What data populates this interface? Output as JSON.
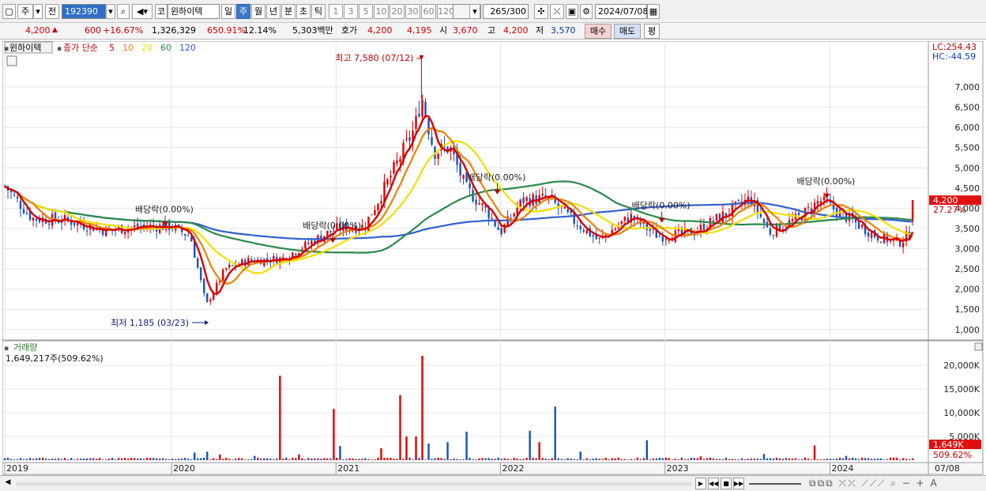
{
  "toolbar": {
    "type_label": "주",
    "jeon_label": "전",
    "code": "192390",
    "code_prefix": "코",
    "name": "윈하이텍",
    "period_buttons": [
      "일",
      "주",
      "월",
      "년",
      "분",
      "초",
      "틱"
    ],
    "active_period": "주",
    "interval_buttons": [
      "1",
      "3",
      "5",
      "10",
      "20",
      "30",
      "60",
      "120"
    ],
    "count_shown": "265",
    "count_total": "/300",
    "date": "2024/07/08"
  },
  "quote": {
    "price": "4,200",
    "change": "600",
    "change_pct": "+16.67%",
    "volume": "1,326,329",
    "volume_ratio": "650.91%",
    "turnover": "12.14%",
    "amount": "5,303백만",
    "hoga_label": "호가",
    "ask": "4,200",
    "bid": "4,195",
    "open_label": "시",
    "open": "3,670",
    "high_label": "고",
    "high": "4,200",
    "low_label": "저",
    "low": "3,570",
    "buy_label": "매수",
    "sell_label": "매도",
    "flat_label": "평"
  },
  "legend": {
    "name": "윈하이텍",
    "ma_title": "종가 단순",
    "periods": [
      "5",
      "10",
      "20",
      "60",
      "120"
    ],
    "colors": [
      "#d40000",
      "#f08000",
      "#f0e000",
      "#2a8a4a",
      "#3060d0"
    ]
  },
  "colors": {
    "up": "#e00000",
    "down": "#1850c0",
    "grid": "#e4e4e4",
    "price_badge": "#e01010"
  },
  "chart_data": [
    {
      "type": "candlestick",
      "title": "윈하이텍",
      "x_unit": "week",
      "x_range": [
        "2019-01-02",
        "2024-07-08"
      ],
      "xticks": [
        "2019",
        "2020",
        "2021",
        "2022",
        "2023",
        "2024",
        "07/08"
      ],
      "ylim": [
        800,
        7900
      ],
      "yticks": [
        "1,000",
        "1,500",
        "2,000",
        "2,500",
        "3,000",
        "3,500",
        "4,000",
        "4,500",
        "5,000",
        "5,500",
        "6,000",
        "6,500",
        "7,000"
      ],
      "right_labels": {
        "lc": "LC:254.43",
        "hc": "HC:-44.59",
        "last_price": "4,200",
        "last_pct": "27.27%"
      },
      "grid": true,
      "legend_position": "top-left",
      "anchor_points": [
        [
          "2019-01-02",
          4550
        ],
        [
          "2019-03-04",
          3750
        ],
        [
          "2019-05-20",
          3700
        ],
        [
          "2019-08-12",
          3450
        ],
        [
          "2019-11-04",
          3550
        ],
        [
          "2020-01-06",
          3550
        ],
        [
          "2020-02-17",
          3300
        ],
        [
          "2020-03-23",
          1600
        ],
        [
          "2020-05-04",
          2500
        ],
        [
          "2020-06-22",
          2700
        ],
        [
          "2020-09-07",
          2750
        ],
        [
          "2020-11-16",
          3200
        ],
        [
          "2021-01-04",
          3500
        ],
        [
          "2021-03-08",
          3550
        ],
        [
          "2021-04-26",
          4600
        ],
        [
          "2021-06-28",
          6000
        ],
        [
          "2021-07-12",
          6800
        ],
        [
          "2021-08-09",
          5400
        ],
        [
          "2021-09-13",
          5500
        ],
        [
          "2021-10-18",
          4500
        ],
        [
          "2021-12-06",
          3900
        ],
        [
          "2022-01-03",
          3400
        ],
        [
          "2022-02-21",
          4200
        ],
        [
          "2022-04-18",
          4250
        ],
        [
          "2022-06-13",
          3700
        ],
        [
          "2022-08-08",
          3200
        ],
        [
          "2022-10-17",
          3800
        ],
        [
          "2022-12-19",
          3300
        ],
        [
          "2023-03-06",
          3400
        ],
        [
          "2023-05-22",
          3900
        ],
        [
          "2023-07-10",
          4250
        ],
        [
          "2023-08-21",
          3400
        ],
        [
          "2023-10-30",
          3800
        ],
        [
          "2023-12-11",
          4200
        ],
        [
          "2024-02-05",
          3800
        ],
        [
          "2024-04-15",
          3300
        ],
        [
          "2024-06-03",
          3150
        ],
        [
          "2024-07-01",
          3400
        ],
        [
          "2024-07-08",
          4200
        ]
      ],
      "annotations": [
        {
          "text": "최고 7,580 (07/12)",
          "x": "2021-07-12",
          "y": 7580,
          "kind": "high"
        },
        {
          "text": "최저 1,185 (03/23)",
          "x": "2020-03-23",
          "y": 1185,
          "kind": "low"
        },
        {
          "text": "배당락(0.00%)",
          "x": "2019-12-23",
          "y": 3700,
          "kind": "dividend"
        },
        {
          "text": "배당락(0.00%)",
          "x": "2020-12-28",
          "y": 3300,
          "kind": "dividend"
        },
        {
          "text": "배당락(0.00%)",
          "x": "2021-12-27",
          "y": 4500,
          "kind": "dividend"
        },
        {
          "text": "배당락(0.00%)",
          "x": "2022-12-26",
          "y": 3800,
          "kind": "dividend"
        },
        {
          "text": "배당락(0.00%)",
          "x": "2023-12-26",
          "y": 4400,
          "kind": "dividend"
        }
      ]
    },
    {
      "type": "bar",
      "title": "거래량",
      "subtitle": "1,649,217주(509.62%)",
      "ylim": [
        0,
        23000
      ],
      "yticks": [
        "5,000K",
        "10,000K",
        "15,000K",
        "20,000K"
      ],
      "right_labels": {
        "last_volume": "1,649K",
        "last_pct": "509.62%"
      },
      "typical_weekly_volume_k": 300,
      "spikes": [
        {
          "x": "2020-02-24",
          "value": 1600
        },
        {
          "x": "2020-03-23",
          "value": 1800
        },
        {
          "x": "2020-04-20",
          "value": 1200
        },
        {
          "x": "2020-07-06",
          "value": 900
        },
        {
          "x": "2020-08-31",
          "value": 17800
        },
        {
          "x": "2020-10-12",
          "value": 1200
        },
        {
          "x": "2020-12-28",
          "value": 10800
        },
        {
          "x": "2021-01-11",
          "value": 3000
        },
        {
          "x": "2021-04-12",
          "value": 2500
        },
        {
          "x": "2021-05-24",
          "value": 13700
        },
        {
          "x": "2021-06-07",
          "value": 5000
        },
        {
          "x": "2021-06-28",
          "value": 5000
        },
        {
          "x": "2021-07-12",
          "value": 22000
        },
        {
          "x": "2021-07-26",
          "value": 3500
        },
        {
          "x": "2021-09-06",
          "value": 3800
        },
        {
          "x": "2021-10-18",
          "value": 6000
        },
        {
          "x": "2022-03-07",
          "value": 6200
        },
        {
          "x": "2022-03-28",
          "value": 3800
        },
        {
          "x": "2022-05-02",
          "value": 11300
        },
        {
          "x": "2022-06-27",
          "value": 1800
        },
        {
          "x": "2022-11-21",
          "value": 4200
        },
        {
          "x": "2023-03-20",
          "value": 800
        },
        {
          "x": "2023-08-07",
          "value": 1300
        },
        {
          "x": "2023-11-27",
          "value": 3100
        },
        {
          "x": "2024-02-05",
          "value": 900
        },
        {
          "x": "2024-07-08",
          "value": 1649
        }
      ]
    }
  ]
}
